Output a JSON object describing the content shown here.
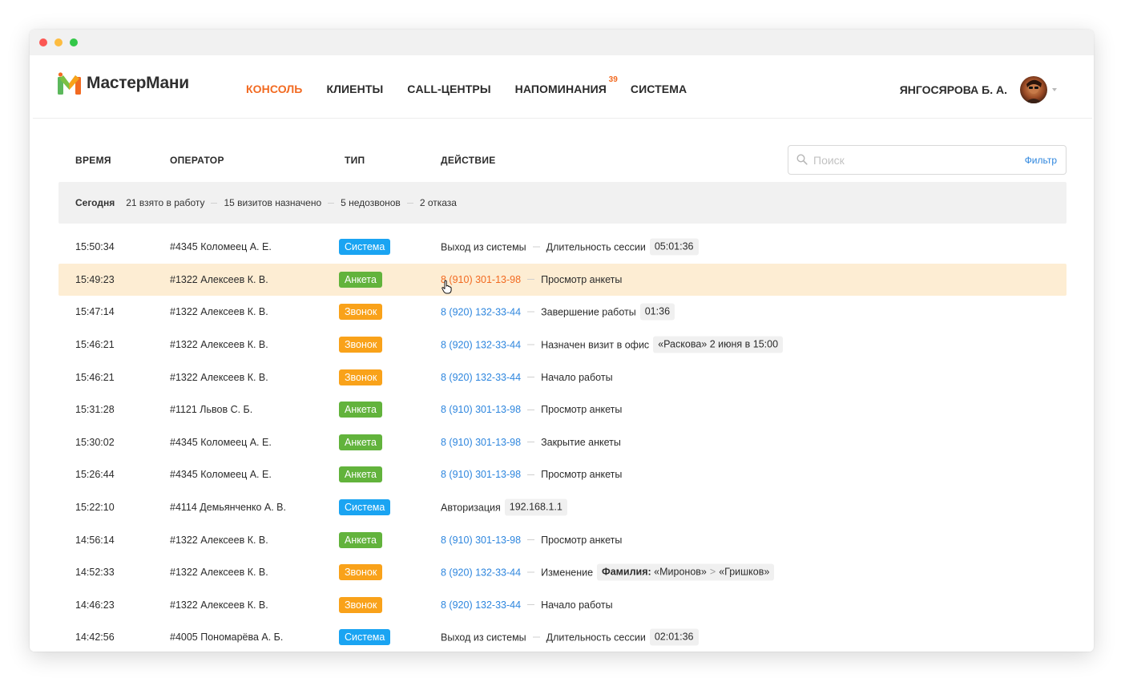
{
  "app": {
    "logo_text": "МастерМани"
  },
  "nav": [
    {
      "label": "КОНСОЛЬ",
      "active": true
    },
    {
      "label": "КЛИЕНТЫ"
    },
    {
      "label": "CALL-ЦЕНТРЫ"
    },
    {
      "label": "НАПОМИНАНИЯ",
      "badge": "39"
    },
    {
      "label": "СИСТЕМА"
    }
  ],
  "user": {
    "name": "ЯНГОСЯРОВА Б. А."
  },
  "columns": {
    "time": "ВРЕМЯ",
    "operator": "ОПЕРАТОР",
    "type": "ТИП",
    "action": "ДЕЙСТВИЕ"
  },
  "search": {
    "placeholder": "Поиск",
    "value": "",
    "filter_label": "Фильтр"
  },
  "summary": {
    "today": "Сегодня",
    "items": [
      "21 взято в работу",
      "15 визитов назначено",
      "5 недозвонов",
      "2 отказа"
    ]
  },
  "type_colors": {
    "Система": "#1aa4f2",
    "Анкета": "#62b33c",
    "Звонок": "#f9a21a"
  },
  "accent_color": "#f26a21",
  "link_color": "#2e86de",
  "rows": [
    {
      "time": "15:50:34",
      "operator": "#4345 Коломеец А. Е.",
      "type": "Система",
      "type_key": "sistema",
      "phone": "",
      "action": "Выход из системы",
      "extra": "Длительность сессии",
      "chip": "05:01:36"
    },
    {
      "time": "15:49:23",
      "operator": "#1322 Алексеев К. В.",
      "type": "Анкета",
      "type_key": "anketa",
      "phone": "8 (910) 301-13-98",
      "action": "Просмотр анкеты",
      "highlight": true
    },
    {
      "time": "15:47:14",
      "operator": "#1322 Алексеев К. В.",
      "type": "Звонок",
      "type_key": "zvonok",
      "phone": "8 (920) 132-33-44",
      "action": "Завершение работы",
      "chip": "01:36"
    },
    {
      "time": "15:46:21",
      "operator": "#1322 Алексеев К. В.",
      "type": "Звонок",
      "type_key": "zvonok",
      "phone": "8 (920) 132-33-44",
      "action": "Назначен визит в офис",
      "chip": "«Раскова» 2 июня в 15:00"
    },
    {
      "time": "15:46:21",
      "operator": "#1322 Алексеев К. В.",
      "type": "Звонок",
      "type_key": "zvonok",
      "phone": "8 (920) 132-33-44",
      "action": "Начало работы"
    },
    {
      "time": "15:31:28",
      "operator": "#1121 Львов С. Б.",
      "type": "Анкета",
      "type_key": "anketa",
      "phone": "8 (910) 301-13-98",
      "action": "Просмотр анкеты"
    },
    {
      "time": "15:30:02",
      "operator": "#4345 Коломеец А. Е.",
      "type": "Анкета",
      "type_key": "anketa",
      "phone": "8 (910) 301-13-98",
      "action": "Закрытие анкеты"
    },
    {
      "time": "15:26:44",
      "operator": "#4345 Коломеец А. Е.",
      "type": "Анкета",
      "type_key": "anketa",
      "phone": "8 (910) 301-13-98",
      "action": "Просмотр анкеты"
    },
    {
      "time": "15:22:10",
      "operator": "#4114 Демьянченко А. В.",
      "type": "Система",
      "type_key": "sistema",
      "phone": "",
      "action": "Авторизация",
      "chip": "192.168.1.1"
    },
    {
      "time": "14:56:14",
      "operator": "#1322 Алексеев К. В.",
      "type": "Анкета",
      "type_key": "anketa",
      "phone": "8 (910) 301-13-98",
      "action": "Просмотр анкеты"
    },
    {
      "time": "14:52:33",
      "operator": "#1322 Алексеев К. В.",
      "type": "Звонок",
      "type_key": "zvonok",
      "phone": "8 (920) 132-33-44",
      "action": "Изменение",
      "change": {
        "field": "Фамилия:",
        "from": "«Миронов»",
        "arrow": ">",
        "to": "«Гришков»"
      }
    },
    {
      "time": "14:46:23",
      "operator": "#1322 Алексеев К. В.",
      "type": "Звонок",
      "type_key": "zvonok",
      "phone": "8 (920) 132-33-44",
      "action": "Начало работы"
    },
    {
      "time": "14:42:56",
      "operator": "#4005 Пономарёва А. Б.",
      "type": "Система",
      "type_key": "sistema",
      "phone": "",
      "action": "Выход из системы",
      "extra": "Длительность сессии",
      "chip": "02:01:36"
    }
  ]
}
